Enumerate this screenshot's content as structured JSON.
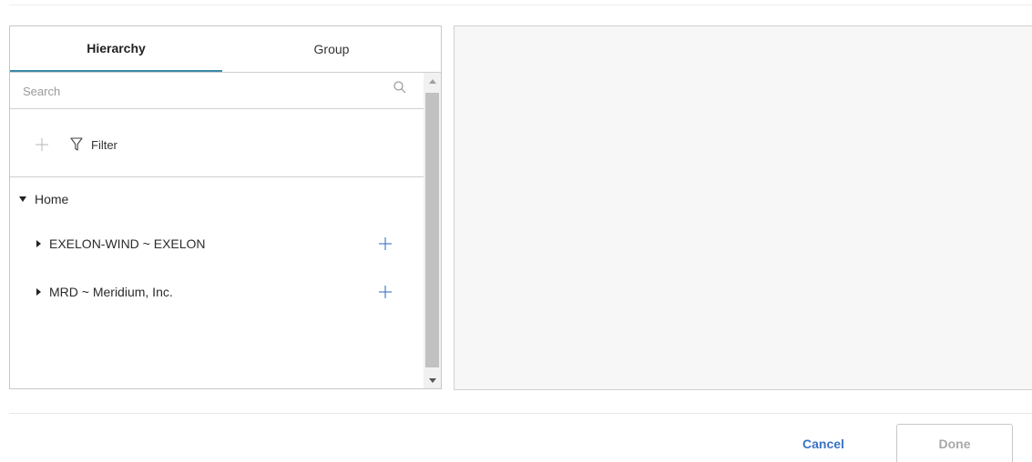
{
  "tabs": [
    {
      "label": "Hierarchy",
      "active": true
    },
    {
      "label": "Group",
      "active": false
    }
  ],
  "search": {
    "placeholder": "Search",
    "value": ""
  },
  "toolbar": {
    "filter_label": "Filter"
  },
  "tree": {
    "root": {
      "label": "Home",
      "expanded": true
    },
    "children": [
      {
        "label": "EXELON-WIND ~ EXELON",
        "expanded": false
      },
      {
        "label": "MRD ~ Meridium, Inc.",
        "expanded": false
      }
    ]
  },
  "footer": {
    "cancel_label": "Cancel",
    "done_label": "Done"
  },
  "colors": {
    "accent": "#3a74c4",
    "tab_underline": "#3a8aa8",
    "disabled_text": "#a9a9a9"
  },
  "icons": [
    "search-icon",
    "add-icon",
    "filter-icon",
    "caret-down-icon",
    "caret-right-icon",
    "scroll-up-icon",
    "scroll-down-icon"
  ]
}
